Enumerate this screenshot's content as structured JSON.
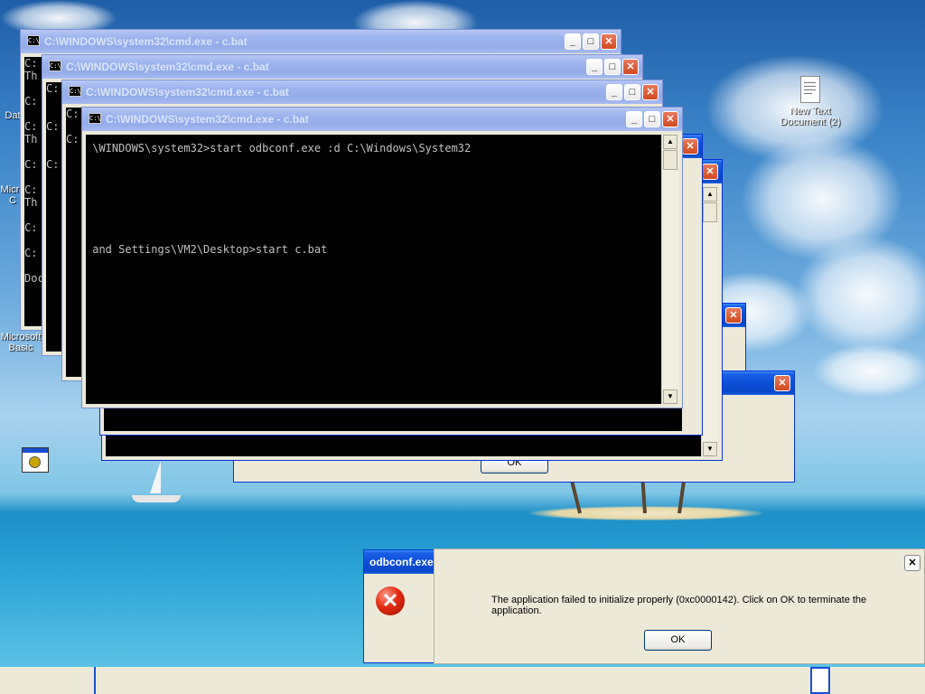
{
  "desktop": {
    "icons": [
      {
        "label_lines": [
          "Dat"
        ],
        "kind": "partial"
      },
      {
        "label_lines": [
          "Micro",
          "C"
        ],
        "kind": "partial"
      },
      {
        "label_lines": [
          "Microsoft",
          "Basic"
        ],
        "kind": "partial"
      },
      {
        "label_lines": [
          "New Text",
          "Document (2)"
        ],
        "kind": "text-document"
      },
      {
        "label_lines": [
          ""
        ],
        "kind": "program"
      }
    ]
  },
  "cmd_windows": [
    {
      "title": "C:\\WINDOWS\\system32\\cmd.exe - c.bat",
      "console_lines": [
        "C:",
        "Th",
        "",
        "C:",
        "",
        "C:",
        "Th",
        "",
        "C:",
        "",
        "C:",
        "Th",
        "",
        "C:",
        "",
        "C:",
        "",
        "Documen"
      ]
    },
    {
      "title": "C:\\WINDOWS\\system32\\cmd.exe - c.bat",
      "console_lines": [
        "C:",
        "",
        "",
        "C:",
        "",
        "",
        "C:"
      ]
    },
    {
      "title": "C:\\WINDOWS\\system32\\cmd.exe - c.bat",
      "console_lines": [
        "C:",
        "",
        "C:"
      ]
    },
    {
      "title": "C:\\WINDOWS\\system32\\cmd.exe - c.bat",
      "console_lines": [
        " \\WINDOWS\\system32>start odbconf.exe :d C:\\Windows\\System32",
        "",
        "",
        "",
        "",
        "",
        "",
        "",
        " and Settings\\VM2\\Desktop>start c.bat"
      ]
    }
  ],
  "dialogs": {
    "behind_ok_label": "OK",
    "error": {
      "title": "odbconf.exe",
      "message": "The application failed to initialize properly (0xc0000142). Click on OK to terminate the application.",
      "ok_label": "OK"
    }
  },
  "titlebar_buttons": {
    "minimize": "_",
    "maximize": "□",
    "close": "✕"
  },
  "colors": {
    "active_title": "#0b4fd7",
    "console_bg": "#000000",
    "console_text": "#c0c0c0",
    "error_red": "#e22b10"
  }
}
